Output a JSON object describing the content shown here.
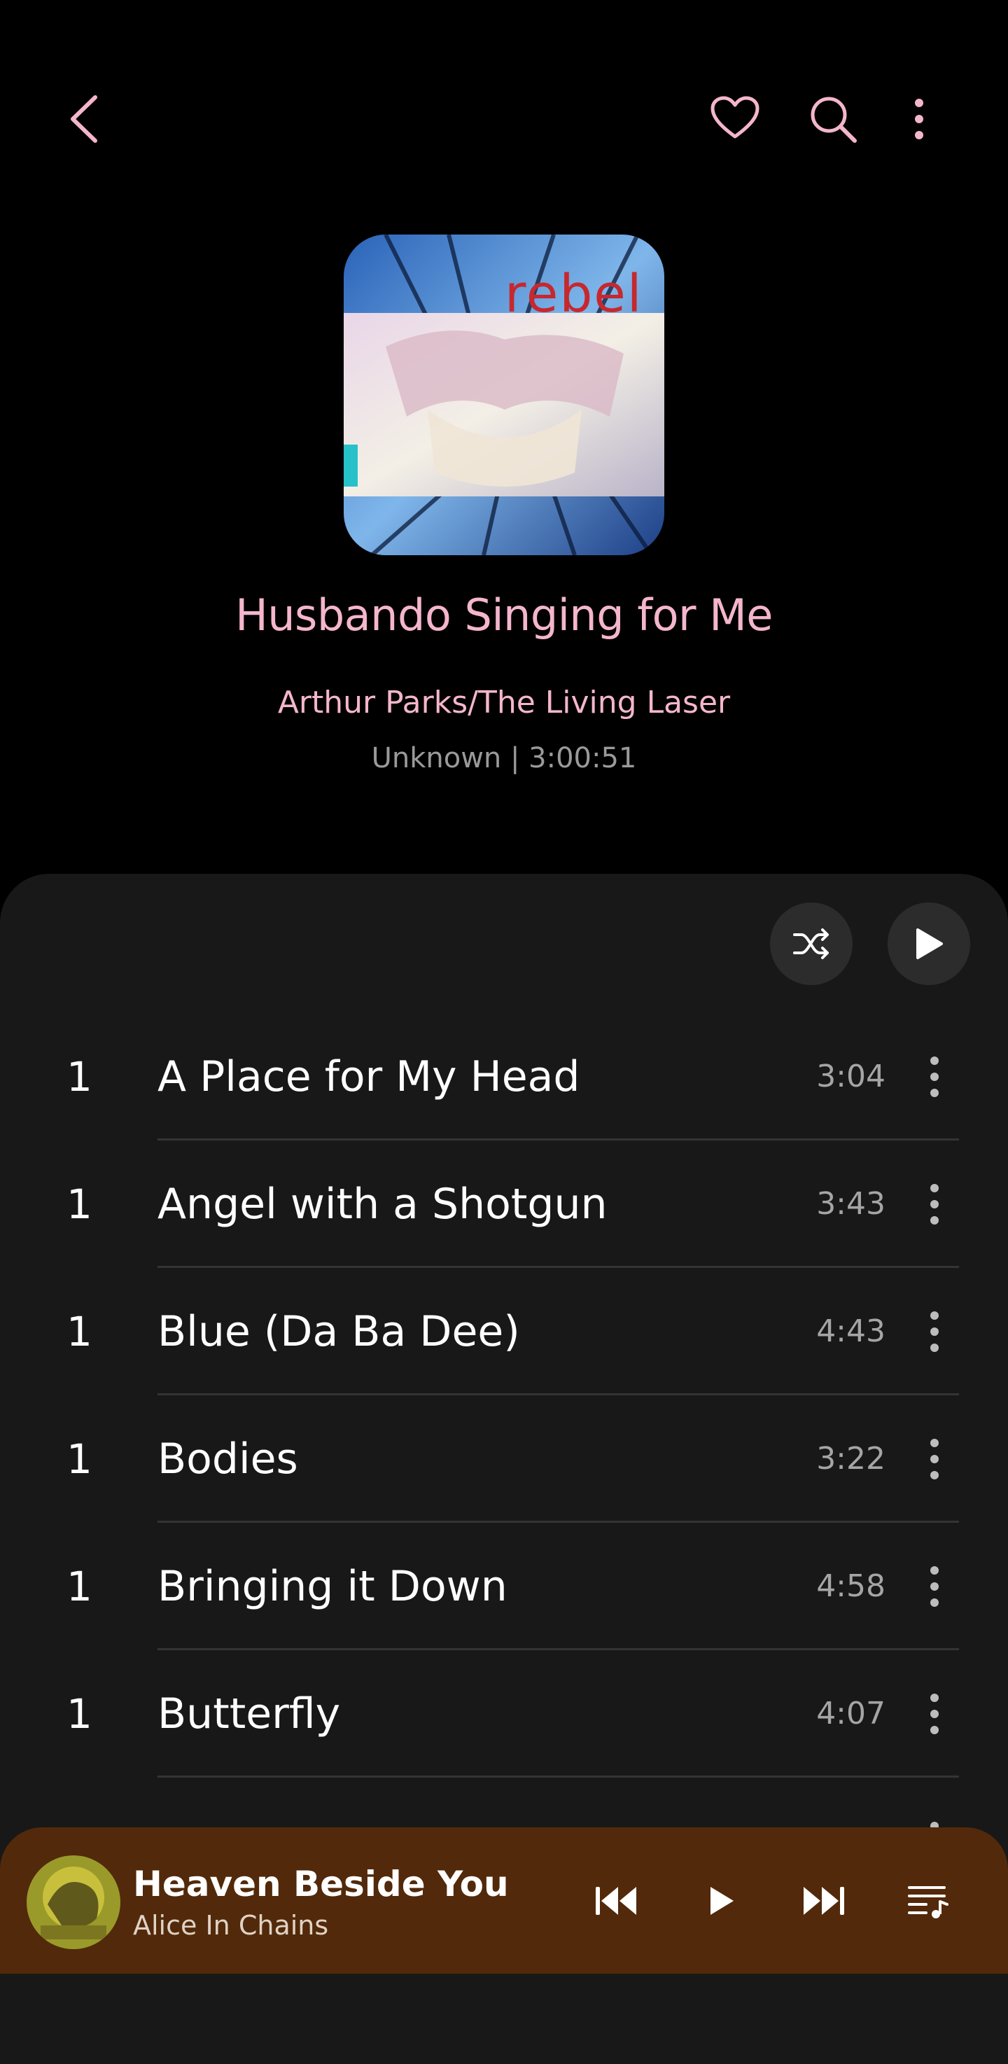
{
  "header": {
    "back_icon": "back-chevron-icon",
    "favorite_icon": "heart-icon",
    "search_icon": "search-icon",
    "more_icon": "more-vertical-icon",
    "accent_color": "#f4b6cc"
  },
  "album": {
    "title": "Husbando Singing for Me",
    "artist": "Arthur Parks/The Living Laser",
    "meta": "Unknown | 3:00:51",
    "cover_text": "rebel"
  },
  "controls": {
    "shuffle_icon": "shuffle-icon",
    "play_icon": "play-icon"
  },
  "tracks": [
    {
      "number": "1",
      "title": "A Place for My Head",
      "duration": "3:04"
    },
    {
      "number": "1",
      "title": "Angel with a Shotgun",
      "duration": "3:43"
    },
    {
      "number": "1",
      "title": "Blue (Da Ba Dee)",
      "duration": "4:43"
    },
    {
      "number": "1",
      "title": "Bodies",
      "duration": "3:22"
    },
    {
      "number": "1",
      "title": "Bringing it Down",
      "duration": "4:58"
    },
    {
      "number": "1",
      "title": "Butterfly",
      "duration": "4:07"
    }
  ],
  "mini_player": {
    "title": "Heaven Beside You",
    "artist": "Alice In Chains",
    "background_color": "#52290a",
    "prev_icon": "skip-previous-icon",
    "play_icon": "play-icon",
    "next_icon": "skip-next-icon",
    "queue_icon": "queue-music-icon"
  }
}
